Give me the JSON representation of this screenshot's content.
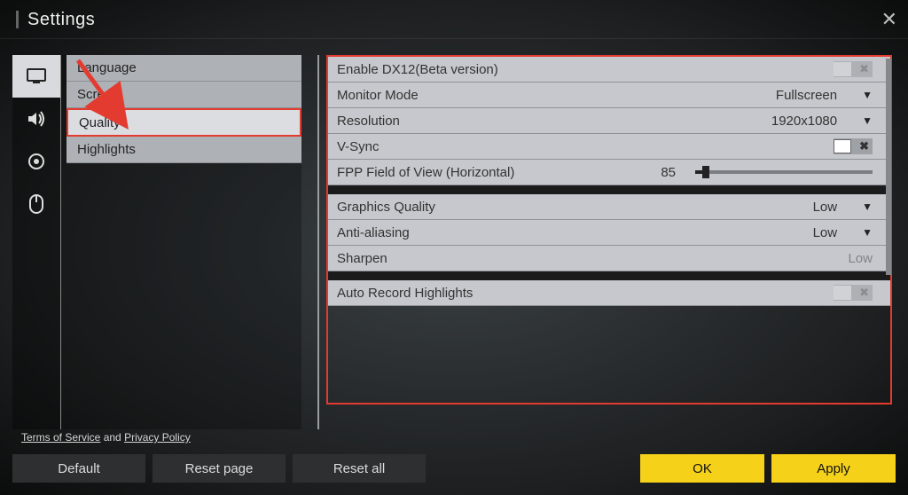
{
  "title": "Settings",
  "sidebar": {
    "icons": [
      "display",
      "audio",
      "accessibility",
      "mouse"
    ],
    "submenu": [
      {
        "label": "Language"
      },
      {
        "label": "Screen"
      },
      {
        "label": "Quality",
        "selected": true
      },
      {
        "label": "Highlights"
      }
    ]
  },
  "settings": {
    "enable_dx12": {
      "label": "Enable DX12(Beta version)",
      "toggle": "off",
      "disabled": true
    },
    "monitor_mode": {
      "label": "Monitor Mode",
      "value": "Fullscreen",
      "dropdown": true
    },
    "resolution": {
      "label": "Resolution",
      "value": "1920x1080",
      "dropdown": true
    },
    "vsync": {
      "label": "V-Sync",
      "toggle": "off"
    },
    "fov": {
      "label": "FPP Field of View (Horizontal)",
      "value": "85",
      "min": 80,
      "max": 103,
      "fill_pct": 4
    },
    "graphics_quality": {
      "label": "Graphics Quality",
      "value": "Low",
      "dropdown": true
    },
    "anti_aliasing": {
      "label": "Anti-aliasing",
      "value": "Low",
      "dropdown": true
    },
    "sharpen": {
      "label": "Sharpen",
      "value": "Low",
      "readonly": true
    },
    "auto_record": {
      "label": "Auto Record Highlights",
      "toggle": "off",
      "disabled": true
    }
  },
  "legal": {
    "tos": "Terms of Service",
    "and": " and ",
    "privacy": "Privacy Policy"
  },
  "footer": {
    "default": "Default",
    "reset_page": "Reset page",
    "reset_all": "Reset all",
    "ok": "OK",
    "apply": "Apply"
  }
}
